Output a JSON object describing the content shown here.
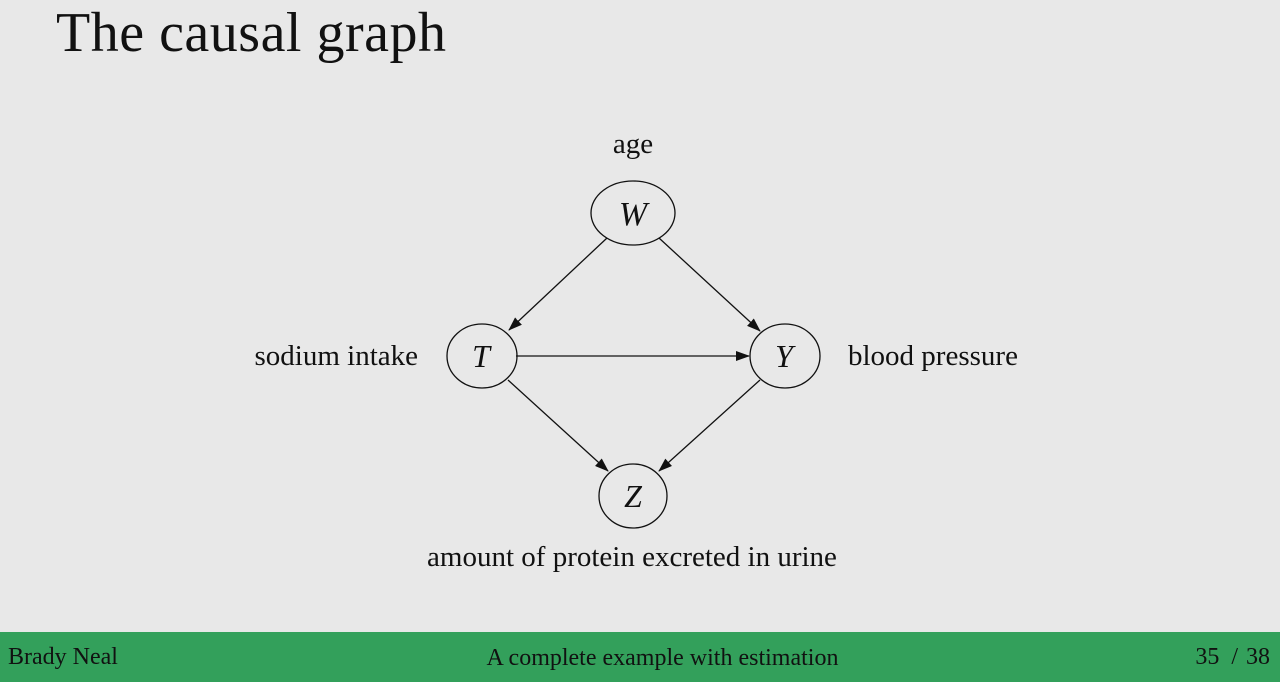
{
  "slide": {
    "title": "The causal graph"
  },
  "graph": {
    "nodes": {
      "W": {
        "symbol": "W",
        "label": "age"
      },
      "T": {
        "symbol": "T",
        "label": "sodium intake"
      },
      "Y": {
        "symbol": "Y",
        "label": "blood pressure"
      },
      "Z": {
        "symbol": "Z",
        "label": "amount of protein excreted in urine"
      }
    },
    "edges": [
      [
        "W",
        "T"
      ],
      [
        "W",
        "Y"
      ],
      [
        "T",
        "Y"
      ],
      [
        "T",
        "Z"
      ],
      [
        "Y",
        "Z"
      ]
    ]
  },
  "footer": {
    "author": "Brady Neal",
    "section_title": "A complete example with estimation",
    "current_page": "35",
    "separator": "/",
    "total_pages": "38"
  },
  "colors": {
    "background": "#e8e8e8",
    "footer_bar": "#33a05b",
    "ink": "#111111"
  }
}
